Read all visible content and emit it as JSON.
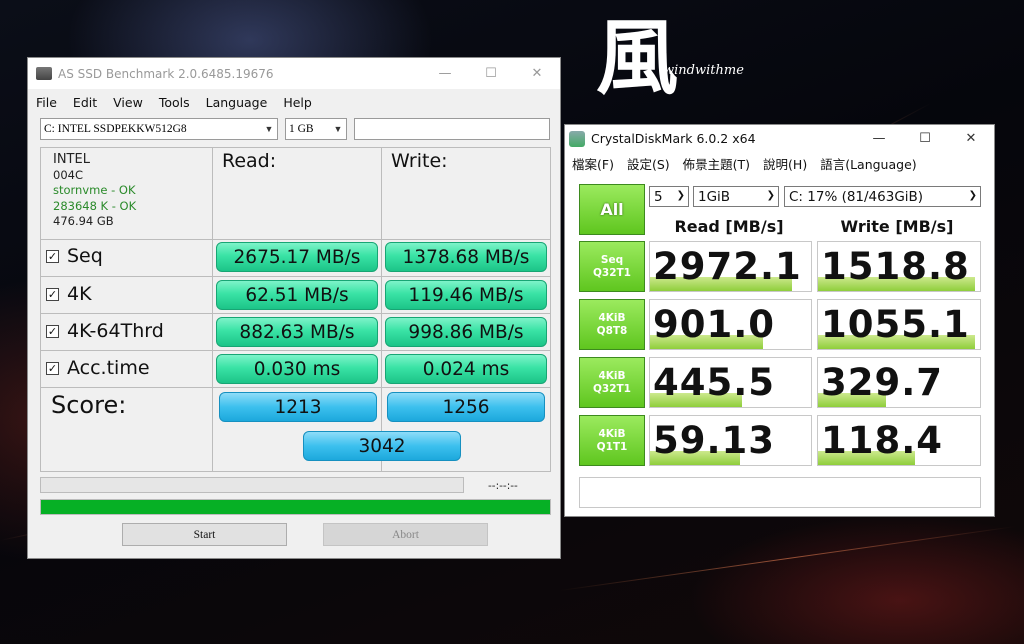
{
  "asssd": {
    "title": "AS SSD Benchmark 2.0.6485.19676",
    "menu": [
      "File",
      "Edit",
      "View",
      "Tools",
      "Language",
      "Help"
    ],
    "drive": "C: INTEL SSDPEKKW512G8",
    "size": "1 GB",
    "device": {
      "vendor": "INTEL",
      "firmware": "004C",
      "driver": "stornvme - OK",
      "alignment": "283648 K - OK",
      "capacity": "476.94 GB"
    },
    "read_header": "Read:",
    "write_header": "Write:",
    "rows": [
      {
        "label": "Seq",
        "read": "2675.17 MB/s",
        "write": "1378.68 MB/s"
      },
      {
        "label": "4K",
        "read": "62.51 MB/s",
        "write": "119.46 MB/s"
      },
      {
        "label": "4K-64Thrd",
        "read": "882.63 MB/s",
        "write": "998.86 MB/s"
      },
      {
        "label": "Acc.time",
        "read": "0.030 ms",
        "write": "0.024 ms"
      }
    ],
    "score_label": "Score:",
    "score_read": "1213",
    "score_write": "1256",
    "score_total": "3042",
    "elapsed": "--:--:--",
    "progress": 1.0,
    "start_label": "Start",
    "abort_label": "Abort",
    "progress_color": "#06b025",
    "value_color": "#3ae3a5",
    "score_color": "#3cc0ee"
  },
  "logo": {
    "glyph": "風",
    "text": "windwithme"
  },
  "cdm": {
    "title": "CrystalDiskMark 6.0.2 x64",
    "menu": [
      "檔案(F)",
      "設定(S)",
      "佈景主題(T)",
      "說明(H)",
      "語言(Language)"
    ],
    "all_label": "All",
    "count": "5",
    "size": "1GiB",
    "drive": "C: 17% (81/463GiB)",
    "read_header": "Read [MB/s]",
    "write_header": "Write [MB/s]",
    "tests": [
      {
        "line1": "Seq",
        "line2": "Q32T1",
        "read": "2972.1",
        "write": "1518.8",
        "read_fill": 0.88,
        "write_fill": 0.97
      },
      {
        "line1": "4KiB",
        "line2": "Q8T8",
        "read": "901.0",
        "write": "1055.1",
        "read_fill": 0.7,
        "write_fill": 0.97
      },
      {
        "line1": "4KiB",
        "line2": "Q32T1",
        "read": "445.5",
        "write": "329.7",
        "read_fill": 0.57,
        "write_fill": 0.42
      },
      {
        "line1": "4KiB",
        "line2": "Q1T1",
        "read": "59.13",
        "write": "118.4",
        "read_fill": 0.56,
        "write_fill": 0.6
      }
    ],
    "button_color": "#5fc61f"
  }
}
